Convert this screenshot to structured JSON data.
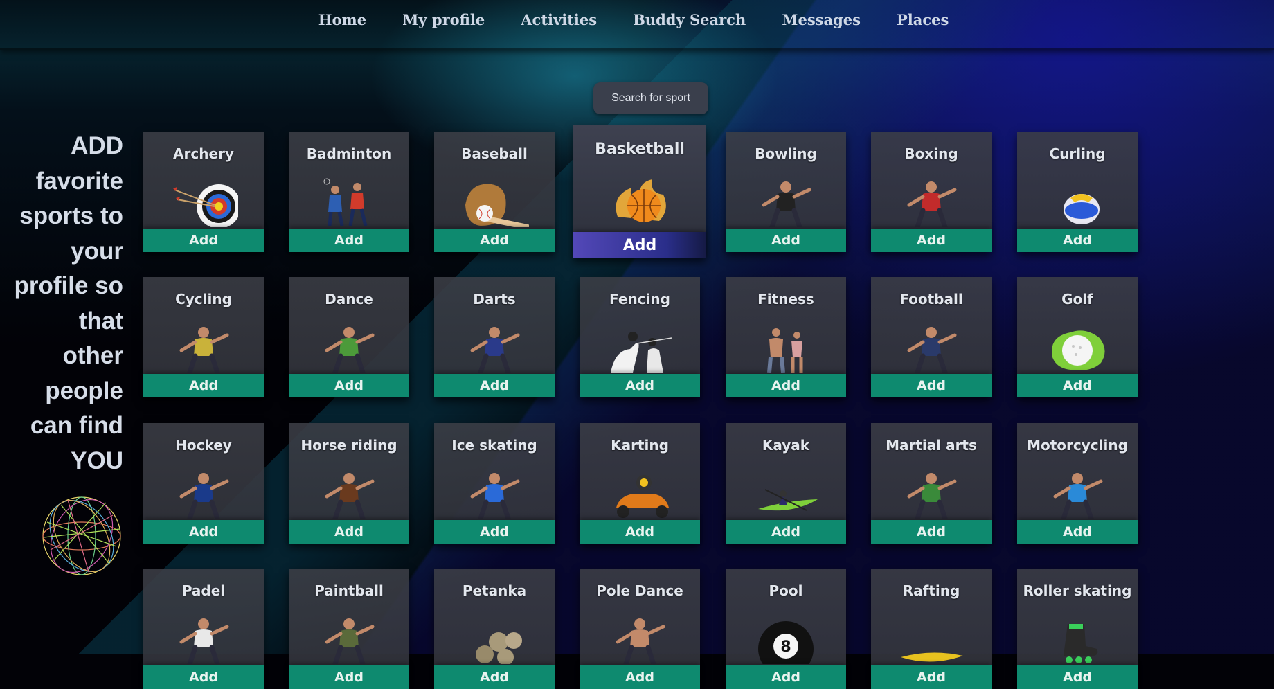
{
  "nav": {
    "items": [
      {
        "label": "Home",
        "name": "nav-home"
      },
      {
        "label": "My profile",
        "name": "nav-my-profile"
      },
      {
        "label": "Activities",
        "name": "nav-activities"
      },
      {
        "label": "Buddy Search",
        "name": "nav-buddy-search"
      },
      {
        "label": "Messages",
        "name": "nav-messages"
      },
      {
        "label": "Places",
        "name": "nav-places"
      }
    ]
  },
  "search": {
    "placeholder": "Search for sport"
  },
  "promo": {
    "lines": [
      "ADD",
      "favorite",
      "sports to",
      "your",
      "profile so",
      "that",
      "other",
      "people",
      "can find",
      "YOU"
    ]
  },
  "sports": [
    {
      "name": "Archery",
      "icon": "archery-target-icon",
      "button": "Add",
      "color": "#d23b2b"
    },
    {
      "name": "Badminton",
      "icon": "badminton-players-icon",
      "button": "Add",
      "color": "#2d5fb3"
    },
    {
      "name": "Baseball",
      "icon": "baseball-glove-icon",
      "button": "Add",
      "color": "#b07a3a"
    },
    {
      "name": "Basketball",
      "icon": "basketball-fire-icon",
      "button": "Add",
      "color": "#f08a1c",
      "active": true
    },
    {
      "name": "Bowling",
      "icon": "bowler-icon",
      "button": "Add",
      "color": "#222222"
    },
    {
      "name": "Boxing",
      "icon": "boxers-icon",
      "button": "Add",
      "color": "#c22b2b"
    },
    {
      "name": "Curling",
      "icon": "curling-stone-icon",
      "button": "Add",
      "color": "#e8c21f"
    },
    {
      "name": "Cycling",
      "icon": "cyclist-icon",
      "button": "Add",
      "color": "#c9b23a"
    },
    {
      "name": "Dance",
      "icon": "dancer-icon",
      "button": "Add",
      "color": "#4c9a3a"
    },
    {
      "name": "Darts",
      "icon": "darts-player-icon",
      "button": "Add",
      "color": "#2a3a8a"
    },
    {
      "name": "Fencing",
      "icon": "fencers-icon",
      "button": "Add",
      "color": "#f2f2f2"
    },
    {
      "name": "Fitness",
      "icon": "fitness-couple-icon",
      "button": "Add",
      "color": "#c28a6a"
    },
    {
      "name": "Football",
      "icon": "football-player-icon",
      "button": "Add",
      "color": "#2a3a6a"
    },
    {
      "name": "Golf",
      "icon": "golf-ball-icon",
      "button": "Add",
      "color": "#7fcf3a"
    },
    {
      "name": "Hockey",
      "icon": "hockey-player-icon",
      "button": "Add",
      "color": "#1a3a8a"
    },
    {
      "name": "Horse riding",
      "icon": "horse-rider-icon",
      "button": "Add",
      "color": "#6a3a1e"
    },
    {
      "name": "Ice skating",
      "icon": "ice-skater-icon",
      "button": "Add",
      "color": "#2a6ad8"
    },
    {
      "name": "Karting",
      "icon": "go-kart-icon",
      "button": "Add",
      "color": "#e07a1a"
    },
    {
      "name": "Kayak",
      "icon": "kayak-icon",
      "button": "Add",
      "color": "#7fd03a"
    },
    {
      "name": "Martial arts",
      "icon": "martial-artist-icon",
      "button": "Add",
      "color": "#3a8a3a"
    },
    {
      "name": "Motorcycling",
      "icon": "motorcycle-rider-icon",
      "button": "Add",
      "color": "#2a8ad8"
    },
    {
      "name": "Padel",
      "icon": "padel-player-icon",
      "button": "Add",
      "color": "#e8e8e8"
    },
    {
      "name": "Paintball",
      "icon": "paintball-player-icon",
      "button": "Add",
      "color": "#5a6a3a"
    },
    {
      "name": "Petanka",
      "icon": "petanque-balls-icon",
      "button": "Add",
      "color": "#a89a7a"
    },
    {
      "name": "Pole Dance",
      "icon": "pole-dancer-icon",
      "button": "Add",
      "color": "#c28a6a"
    },
    {
      "name": "Pool",
      "icon": "eight-ball-icon",
      "button": "Add",
      "color": "#111111"
    },
    {
      "name": "Rafting",
      "icon": "raft-icon",
      "button": "Add",
      "color": "#e8c21f"
    },
    {
      "name": "Roller skating",
      "icon": "roller-skate-icon",
      "button": "Add",
      "color": "#3acf5a"
    }
  ],
  "colors": {
    "add_button": "#0e8a6f",
    "add_button_active": "#5348b8",
    "card": "#3a3c44",
    "search": "#3a3f4c"
  }
}
